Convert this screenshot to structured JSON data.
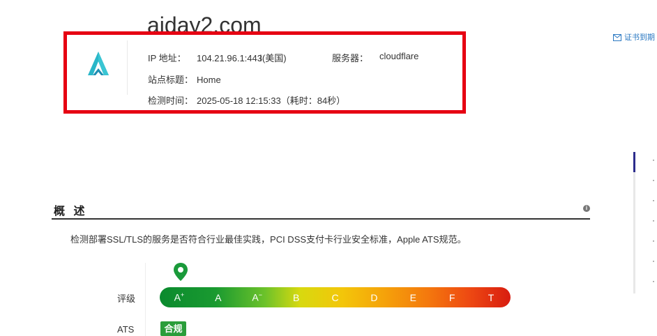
{
  "site": {
    "domain": "aiday2.com"
  },
  "info": {
    "ip_label": "IP 地址：",
    "ip_value": "104.21.96.1:443",
    "ip_location": "(美国)",
    "server_label": "服务器：",
    "server_value": "cloudflare",
    "title_label": "站点标题：",
    "title_value": "Home",
    "time_label": "检测时间：",
    "time_value": "2025-05-18 12:15:33（耗时：84秒）"
  },
  "header_actions": {
    "cert_expiry": "证书到期"
  },
  "toc": {
    "items": [
      "·",
      "·",
      "·",
      "·",
      "·",
      "·",
      "·"
    ]
  },
  "overview": {
    "title": "概 述",
    "description": "检测部署SSL/TLS的服务是否符合行业最佳实践，PCI DSS支付卡行业安全标准，Apple ATS规范。",
    "grade_label": "评级",
    "ats_label": "ATS",
    "ats_status": "合规",
    "grades": [
      "A",
      "A",
      "A",
      "B",
      "C",
      "D",
      "E",
      "F",
      "T"
    ],
    "grade_marks": [
      "+",
      "",
      "−",
      "",
      "",
      "",
      "",
      "",
      ""
    ],
    "current_grade": "A+"
  },
  "colors": {
    "highlight_border": "#e60012",
    "link": "#2a78c2",
    "ats_badge": "#2a9d3a",
    "pin": "#1a9a3a"
  }
}
